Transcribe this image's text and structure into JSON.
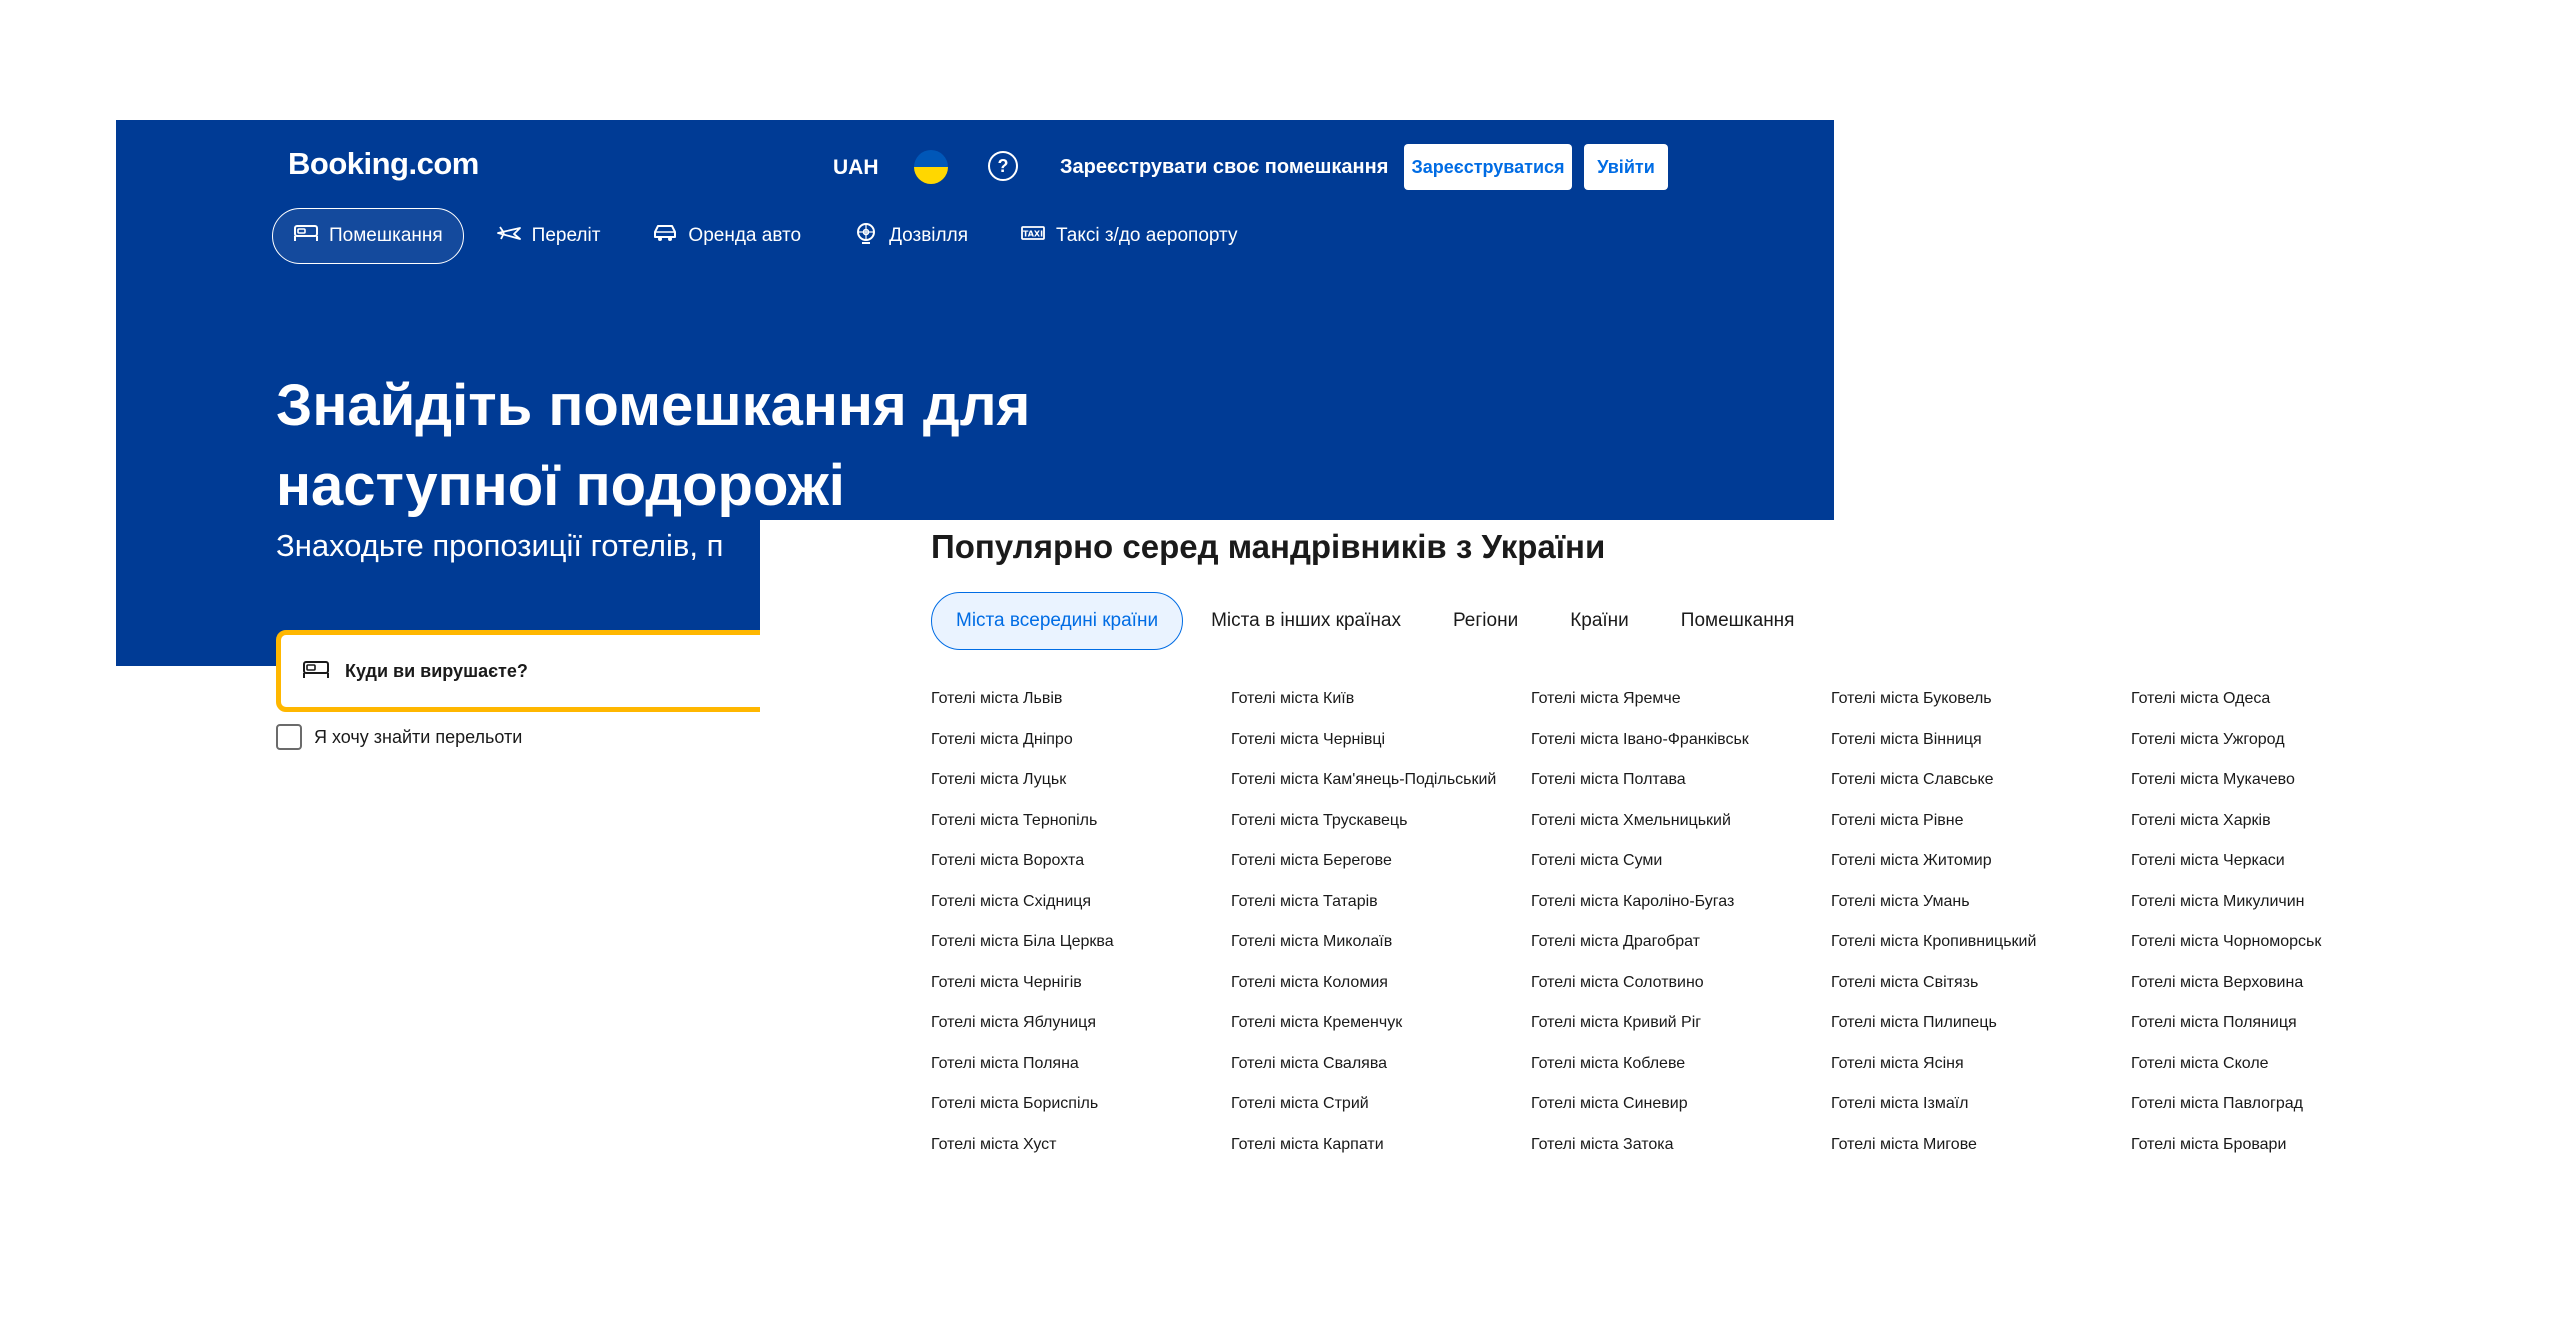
{
  "header": {
    "logo": "Booking.com",
    "currency": "UAH",
    "help_icon": "question-circle-icon",
    "list_property": "Зареєструвати своє помешкання",
    "register_label": "Зареєструватися",
    "login_label": "Увійти"
  },
  "nav": {
    "tabs": [
      {
        "label": "Помешкання",
        "icon": "bed-icon",
        "active": true
      },
      {
        "label": "Переліт",
        "icon": "plane-icon",
        "active": false
      },
      {
        "label": "Оренда авто",
        "icon": "car-icon",
        "active": false
      },
      {
        "label": "Дозвілля",
        "icon": "attractions-icon",
        "active": false
      },
      {
        "label": "Таксі з/до аеропорту",
        "icon": "taxi-icon",
        "active": false
      }
    ]
  },
  "hero": {
    "title_line1": "Знайдіть помешкання для",
    "title_line2": "наступної подорожі",
    "subtitle": "Знаходьте пропозиції готелів, п"
  },
  "search": {
    "placeholder": "Куди ви вирушаєте?",
    "flights_checkbox": "Я хочу знайти перельоти"
  },
  "popular": {
    "title": "Популярно серед мандрівників з України",
    "tabs": [
      {
        "label": "Міста всередині країни",
        "active": true
      },
      {
        "label": "Міста в інших країнах",
        "active": false
      },
      {
        "label": "Регіони",
        "active": false
      },
      {
        "label": "Країни",
        "active": false
      },
      {
        "label": "Помешкання",
        "active": false
      }
    ],
    "columns": [
      [
        "Готелі міста Львів",
        "Готелі міста Дніпро",
        "Готелі міста Луцьк",
        "Готелі міста Тернопіль",
        "Готелі міста Ворохта",
        "Готелі міста Східниця",
        "Готелі міста Біла Церква",
        "Готелі міста Чернігів",
        "Готелі міста Яблуниця",
        "Готелі міста Поляна",
        "Готелі міста Бориспіль",
        "Готелі міста Хуст"
      ],
      [
        "Готелі міста Київ",
        "Готелі міста Чернівці",
        "Готелі міста Кам'янець-Подільський",
        "Готелі міста Трускавець",
        "Готелі міста Берегове",
        "Готелі міста Татарів",
        "Готелі міста Миколаїв",
        "Готелі міста Коломия",
        "Готелі міста Кременчук",
        "Готелі міста Свалява",
        "Готелі міста Стрий",
        "Готелі міста Карпати"
      ],
      [
        "Готелі міста Яремче",
        "Готелі міста Івано-Франківськ",
        "Готелі міста Полтава",
        "Готелі міста Хмельницький",
        "Готелі міста Суми",
        "Готелі міста Кароліно-Бугаз",
        "Готелі міста Драгобрат",
        "Готелі міста Солотвино",
        "Готелі міста Кривий Ріг",
        "Готелі міста Коблеве",
        "Готелі міста Синевир",
        "Готелі міста Затока"
      ],
      [
        "Готелі міста Буковель",
        "Готелі міста Вінниця",
        "Готелі міста Славське",
        "Готелі міста Рівне",
        "Готелі міста Житомир",
        "Готелі міста Умань",
        "Готелі міста Кропивницький",
        "Готелі міста Світязь",
        "Готелі міста Пилипець",
        "Готелі міста Ясіня",
        "Готелі міста Ізмаїл",
        "Готелі міста Мигове"
      ],
      [
        "Готелі міста Одеса",
        "Готелі міста Ужгород",
        "Готелі міста Мукачево",
        "Готелі міста Харків",
        "Готелі міста Черкаси",
        "Готелі міста Микуличин",
        "Готелі міста Чорноморськ",
        "Готелі міста Верховина",
        "Готелі міста Поляниця",
        "Готелі міста Сколе",
        "Готелі міста Павлоград",
        "Готелі міста Бровари"
      ]
    ]
  },
  "colors": {
    "brand_blue": "#003b95",
    "link_blue": "#006ce4",
    "search_border": "#ffb700"
  }
}
